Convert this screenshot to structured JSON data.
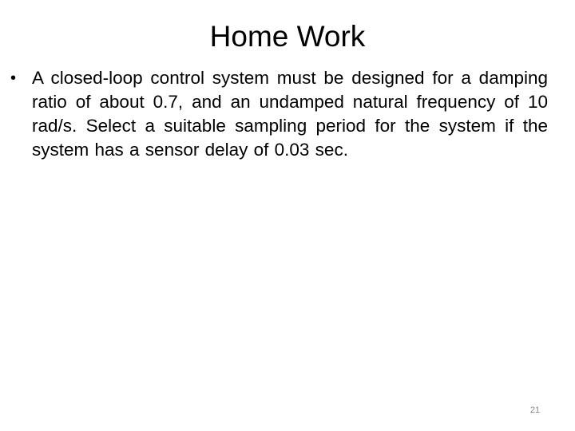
{
  "slide": {
    "title": "Home Work",
    "bullets": [
      {
        "icon": "bullet-dot-icon",
        "glyph": "•",
        "text": "A closed-loop control system must be designed for a damping ratio of about 0.7, and an undamped natural frequency of 10 rad/s. Select a suitable sampling period for the system if the system has a sensor delay of 0.03 sec."
      }
    ],
    "page_number": "21"
  }
}
